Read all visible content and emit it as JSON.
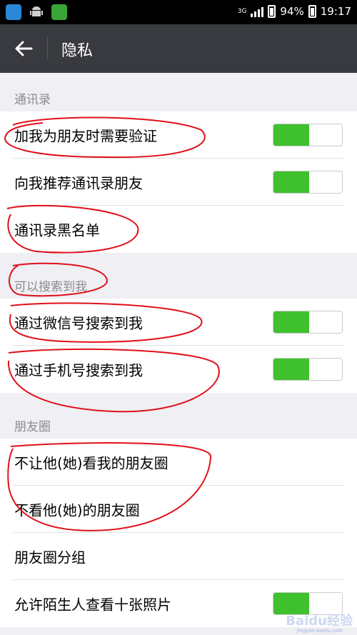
{
  "status_bar": {
    "network": "3G",
    "battery": "94%",
    "time": "19:17",
    "icons": [
      "app-icon",
      "android-icon",
      "security-shield-icon"
    ]
  },
  "title_bar": {
    "back_icon": "arrow-left-icon",
    "title": "隐私"
  },
  "sections": [
    {
      "header": "通讯录",
      "items": [
        {
          "label": "加我为朋友时需要验证",
          "toggle": true
        },
        {
          "label": "向我推荐通讯录朋友",
          "toggle": true
        },
        {
          "label": "通讯录黑名单"
        }
      ]
    },
    {
      "header": "可以搜索到我",
      "items": [
        {
          "label": "通过微信号搜索到我",
          "toggle": true
        },
        {
          "label": "通过手机号搜索到我",
          "toggle": true
        }
      ]
    },
    {
      "header": "朋友圈",
      "items": [
        {
          "label": "不让他(她)看我的朋友圈"
        },
        {
          "label": "不看他(她)的朋友圈"
        },
        {
          "label": "朋友圈分组"
        },
        {
          "label": "允许陌生人查看十张照片",
          "toggle": true
        }
      ]
    }
  ],
  "colors": {
    "accent_green": "#3fc12e",
    "title_bar": "#393a3f",
    "annotation_red": "#e0101a"
  },
  "watermark": "Baidu经验",
  "watermark_sub": "jingyan.baidu.com"
}
